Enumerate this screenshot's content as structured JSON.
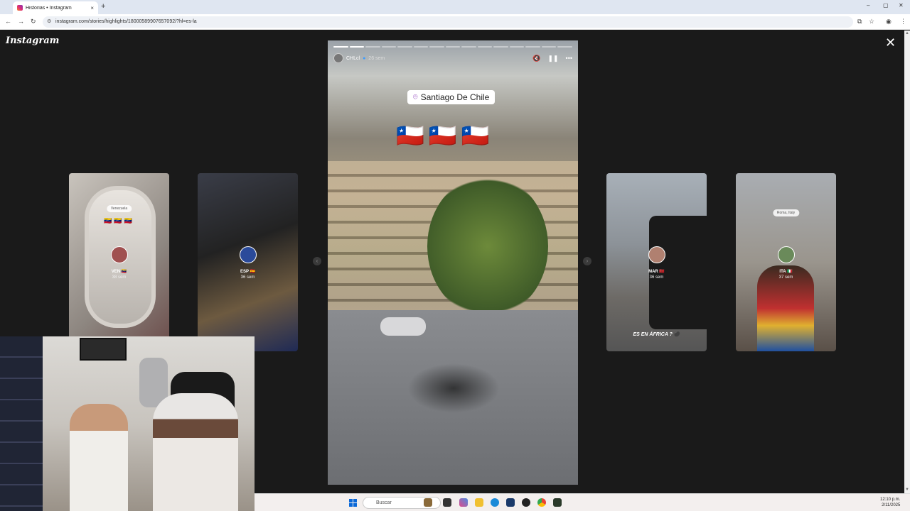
{
  "browser": {
    "tab_title": "Historias • Instagram",
    "tab_close": "×",
    "new_tab": "+",
    "url": "instagram.com/stories/highlights/18000589907657092/?hl=es-la",
    "window_min": "–",
    "window_max": "▢",
    "window_close": "✕"
  },
  "page": {
    "logo": "Instagram",
    "close_glyph": "✕",
    "main_story": {
      "username": "CHLcl",
      "time": "26 sem",
      "location": "Santiago De Chile",
      "flags": "🇨🇱🇨🇱🇨🇱",
      "progress_segments": 15,
      "progress_done": 2
    },
    "side_stories": [
      {
        "pill": "Venezuela",
        "flags": "🇻🇪🇻🇪🇻🇪",
        "name": "VEN 🇻🇪",
        "time": "38 sem"
      },
      {
        "name": "ESP 🇪🇸",
        "time": "36 sem"
      },
      {
        "name": "MAR 🇲🇦",
        "time": "36 sem",
        "caption": "ES EN ÁFRICA ? ⚫"
      },
      {
        "pill": "Roma, Italy",
        "name": "ITA 🇮🇹",
        "time": "37 sem"
      }
    ],
    "prev_arrow": "‹",
    "next_arrow": "›"
  },
  "taskbar": {
    "search_placeholder": "Buscar",
    "clock_time": "12:10 p.m.",
    "clock_date": "2/11/2025"
  },
  "colors": {
    "accent": "#0a68d8",
    "instagram": "#dd2a7b"
  }
}
